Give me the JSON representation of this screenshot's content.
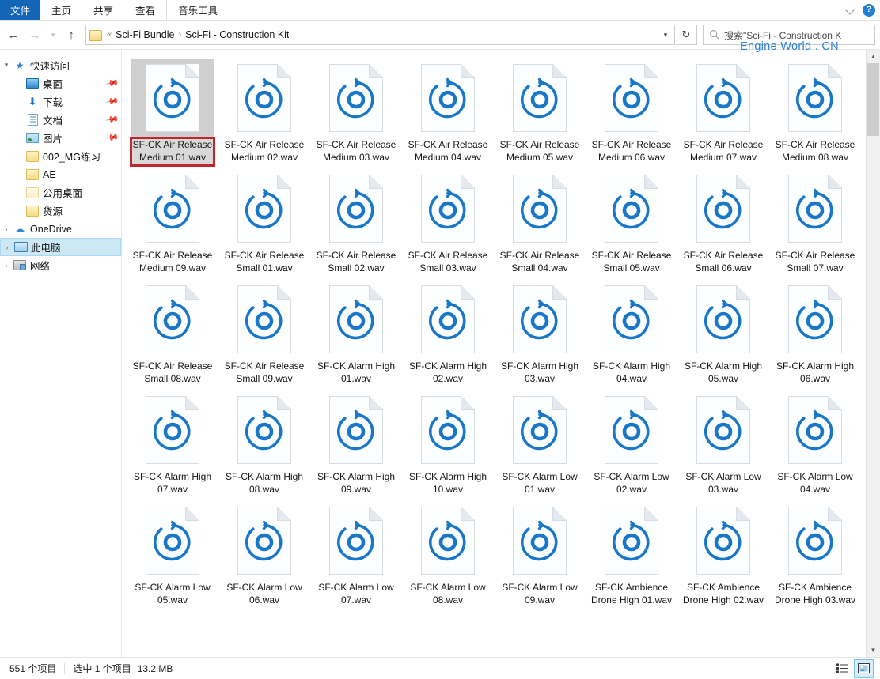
{
  "window": {
    "watermark": "Engine World . CN"
  },
  "ribbon": {
    "tabs": [
      {
        "label": "文件",
        "name": "tab-file",
        "active_style": "file"
      },
      {
        "label": "主页",
        "name": "tab-home"
      },
      {
        "label": "共享",
        "name": "tab-share"
      },
      {
        "label": "查看",
        "name": "tab-view"
      },
      {
        "label": "音乐工具",
        "name": "tab-music-tools"
      }
    ],
    "collapse_icon": "chevron-down-icon",
    "help_icon": "help-icon",
    "help_glyph": "?"
  },
  "addressbar": {
    "back_glyph": "←",
    "forward_glyph": "→",
    "recent_glyph": "▾",
    "up_glyph": "↑",
    "folder_icon": "folder-icon",
    "prefix": "«",
    "crumbs": [
      "Sci-Fi  Bundle",
      "Sci-Fi - Construction Kit"
    ],
    "crumb_separator": "›",
    "dropdown_glyph": "▾",
    "refresh_glyph": "↻",
    "search_placeholder": "搜索\"Sci-Fi - Construction K",
    "search_value": ""
  },
  "sidebar": {
    "items": [
      {
        "label": "快速访问",
        "icon": "star-icon",
        "expander": "▾",
        "indent": 0,
        "pinned": false,
        "selected": false
      },
      {
        "label": "桌面",
        "icon": "desktop-icon",
        "expander": "",
        "indent": 1,
        "pinned": true,
        "selected": false
      },
      {
        "label": "下载",
        "icon": "download-icon",
        "expander": "",
        "indent": 1,
        "pinned": true,
        "selected": false
      },
      {
        "label": "文档",
        "icon": "document-icon",
        "expander": "",
        "indent": 1,
        "pinned": true,
        "selected": false
      },
      {
        "label": "图片",
        "icon": "pictures-icon",
        "expander": "",
        "indent": 1,
        "pinned": true,
        "selected": false
      },
      {
        "label": "002_MG练习",
        "icon": "folder-icon",
        "expander": "",
        "indent": 1,
        "pinned": false,
        "selected": false
      },
      {
        "label": "AE",
        "icon": "folder-icon",
        "expander": "",
        "indent": 1,
        "pinned": false,
        "selected": false
      },
      {
        "label": "公用桌面",
        "icon": "folder-pale-icon",
        "expander": "",
        "indent": 1,
        "pinned": false,
        "selected": false
      },
      {
        "label": "货源",
        "icon": "folder-icon",
        "expander": "",
        "indent": 1,
        "pinned": false,
        "selected": false
      },
      {
        "label": "OneDrive",
        "icon": "cloud-icon",
        "expander": "›",
        "indent": 0,
        "pinned": false,
        "selected": false
      },
      {
        "label": "此电脑",
        "icon": "computer-icon",
        "expander": "›",
        "indent": 0,
        "pinned": false,
        "selected": true
      },
      {
        "label": "网络",
        "icon": "network-icon",
        "expander": "›",
        "indent": 0,
        "pinned": false,
        "selected": false
      }
    ]
  },
  "files": {
    "icon_name": "wav-audio-file-icon",
    "items": [
      {
        "name": "SF-CK Air Release Medium 01.wav",
        "selected": true
      },
      {
        "name": "SF-CK Air Release Medium 02.wav",
        "selected": false
      },
      {
        "name": "SF-CK Air Release Medium 03.wav",
        "selected": false
      },
      {
        "name": "SF-CK Air Release Medium 04.wav",
        "selected": false
      },
      {
        "name": "SF-CK Air Release Medium 05.wav",
        "selected": false
      },
      {
        "name": "SF-CK Air Release Medium 06.wav",
        "selected": false
      },
      {
        "name": "SF-CK Air Release Medium 07.wav",
        "selected": false
      },
      {
        "name": "SF-CK Air Release Medium 08.wav",
        "selected": false
      },
      {
        "name": "SF-CK Air Release Medium 09.wav",
        "selected": false
      },
      {
        "name": "SF-CK Air Release Small 01.wav",
        "selected": false
      },
      {
        "name": "SF-CK Air Release Small 02.wav",
        "selected": false
      },
      {
        "name": "SF-CK Air Release Small 03.wav",
        "selected": false
      },
      {
        "name": "SF-CK Air Release Small 04.wav",
        "selected": false
      },
      {
        "name": "SF-CK Air Release Small 05.wav",
        "selected": false
      },
      {
        "name": "SF-CK Air Release Small 06.wav",
        "selected": false
      },
      {
        "name": "SF-CK Air Release Small 07.wav",
        "selected": false
      },
      {
        "name": "SF-CK Air Release Small 08.wav",
        "selected": false
      },
      {
        "name": "SF-CK Air Release Small 09.wav",
        "selected": false
      },
      {
        "name": "SF-CK Alarm High 01.wav",
        "selected": false
      },
      {
        "name": "SF-CK Alarm High 02.wav",
        "selected": false
      },
      {
        "name": "SF-CK Alarm High 03.wav",
        "selected": false
      },
      {
        "name": "SF-CK Alarm High 04.wav",
        "selected": false
      },
      {
        "name": "SF-CK Alarm High 05.wav",
        "selected": false
      },
      {
        "name": "SF-CK Alarm High 06.wav",
        "selected": false
      },
      {
        "name": "SF-CK Alarm High 07.wav",
        "selected": false
      },
      {
        "name": "SF-CK Alarm High 08.wav",
        "selected": false
      },
      {
        "name": "SF-CK Alarm High 09.wav",
        "selected": false
      },
      {
        "name": "SF-CK Alarm High 10.wav",
        "selected": false
      },
      {
        "name": "SF-CK Alarm Low 01.wav",
        "selected": false
      },
      {
        "name": "SF-CK Alarm Low 02.wav",
        "selected": false
      },
      {
        "name": "SF-CK Alarm Low 03.wav",
        "selected": false
      },
      {
        "name": "SF-CK Alarm Low 04.wav",
        "selected": false
      },
      {
        "name": "SF-CK Alarm Low 05.wav",
        "selected": false
      },
      {
        "name": "SF-CK Alarm Low 06.wav",
        "selected": false
      },
      {
        "name": "SF-CK Alarm Low 07.wav",
        "selected": false
      },
      {
        "name": "SF-CK Alarm Low 08.wav",
        "selected": false
      },
      {
        "name": "SF-CK Alarm Low 09.wav",
        "selected": false
      },
      {
        "name": "SF-CK Ambience Drone High 01.wav",
        "selected": false
      },
      {
        "name": "SF-CK Ambience Drone High 02.wav",
        "selected": false
      },
      {
        "name": "SF-CK Ambience Drone High 03.wav",
        "selected": false
      }
    ]
  },
  "scrollbar": {
    "up_glyph": "▲",
    "down_glyph": "▼"
  },
  "statusbar": {
    "item_count": "551 个项目",
    "selection": "选中 1 个项目",
    "size": "13.2 MB",
    "view_details_icon": "details-view-icon",
    "view_large_icons_icon": "large-icons-view-icon"
  },
  "colors": {
    "accent": "#1266b5",
    "selection_highlight": "#c0272d",
    "nav_selected": "#cce8f4",
    "file_icon_blue": "#1877c9"
  }
}
